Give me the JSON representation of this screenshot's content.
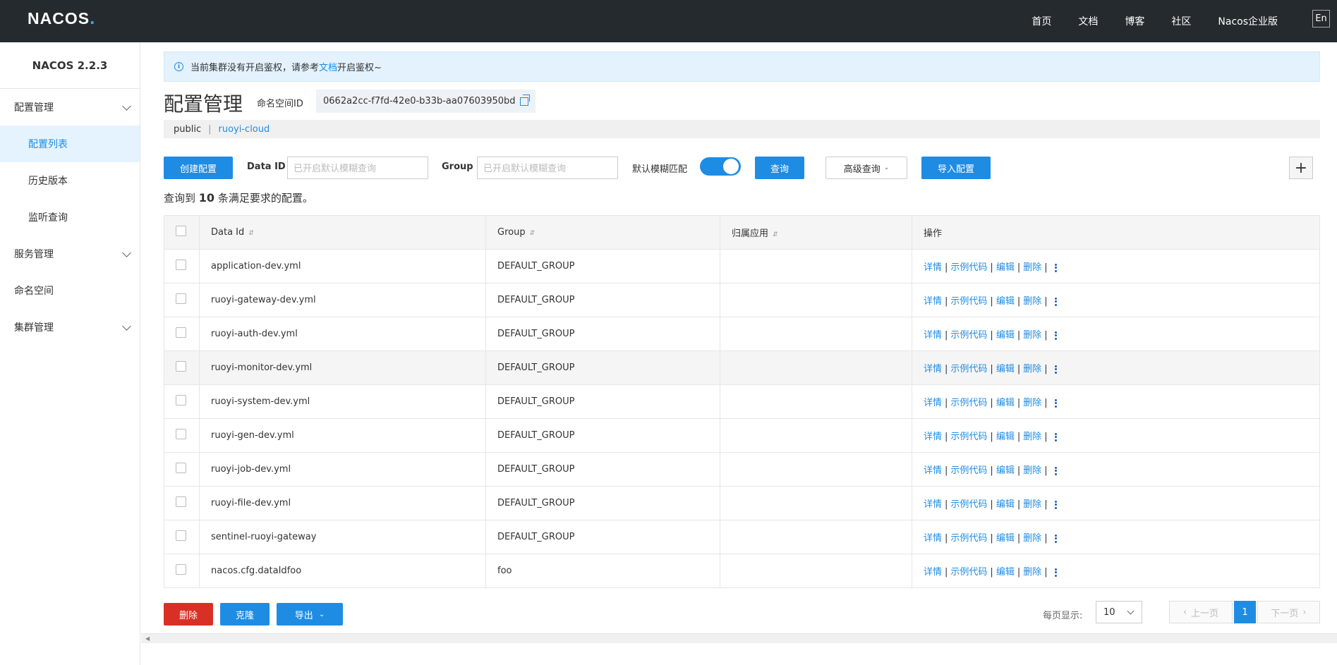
{
  "header": {
    "logo": "NACOS",
    "logo_dot": ".",
    "nav": [
      "首页",
      "文档",
      "博客",
      "社区",
      "Nacos企业版"
    ],
    "lang": "En"
  },
  "sidebar": {
    "version": "NACOS 2.2.3",
    "items": [
      {
        "label": "配置管理",
        "expandable": true
      },
      {
        "label": "配置列表",
        "active": true
      },
      {
        "label": "历史版本"
      },
      {
        "label": "监听查询"
      },
      {
        "label": "服务管理",
        "expandable": true
      },
      {
        "label": "命名空间"
      },
      {
        "label": "集群管理",
        "expandable": true
      }
    ]
  },
  "notice": {
    "text_before": "当前集群没有开启鉴权，请参考",
    "link": "文档",
    "text_after": "开启鉴权~"
  },
  "page": {
    "title": "配置管理",
    "namespace_label": "命名空间ID",
    "namespace_id": "0662a2cc-f7fd-42e0-b33b-aa07603950bd",
    "ns_public": "public",
    "ns_sep": "|",
    "ns_current": "ruoyi-cloud"
  },
  "toolbar": {
    "create": "创建配置",
    "dataid_label": "Data ID",
    "dataid_placeholder": "已开启默认模糊查询",
    "group_label": "Group",
    "group_placeholder": "已开启默认模糊查询",
    "fuzzy_label": "默认模糊匹配",
    "fuzzy_on": true,
    "query": "查询",
    "advanced": "高级查询",
    "import": "导入配置",
    "plus": "+"
  },
  "summary": {
    "prefix": "查询到",
    "count": "10",
    "suffix": "条满足要求的配置。"
  },
  "table": {
    "columns": [
      "Data Id",
      "Group",
      "归属应用",
      "操作"
    ],
    "ops": [
      "详情",
      "示例代码",
      "编辑",
      "删除"
    ],
    "rows": [
      {
        "data_id": "application-dev.yml",
        "group": "DEFAULT_GROUP",
        "app": ""
      },
      {
        "data_id": "ruoyi-gateway-dev.yml",
        "group": "DEFAULT_GROUP",
        "app": ""
      },
      {
        "data_id": "ruoyi-auth-dev.yml",
        "group": "DEFAULT_GROUP",
        "app": ""
      },
      {
        "data_id": "ruoyi-monitor-dev.yml",
        "group": "DEFAULT_GROUP",
        "app": ""
      },
      {
        "data_id": "ruoyi-system-dev.yml",
        "group": "DEFAULT_GROUP",
        "app": ""
      },
      {
        "data_id": "ruoyi-gen-dev.yml",
        "group": "DEFAULT_GROUP",
        "app": ""
      },
      {
        "data_id": "ruoyi-job-dev.yml",
        "group": "DEFAULT_GROUP",
        "app": ""
      },
      {
        "data_id": "ruoyi-file-dev.yml",
        "group": "DEFAULT_GROUP",
        "app": ""
      },
      {
        "data_id": "sentinel-ruoyi-gateway",
        "group": "DEFAULT_GROUP",
        "app": ""
      },
      {
        "data_id": "nacos.cfg.dataIdfoo",
        "group": "foo",
        "app": ""
      }
    ]
  },
  "footer": {
    "delete": "删除",
    "clone": "克隆",
    "export": "导出",
    "page_size_label": "每页显示:",
    "page_size": "10",
    "prev": "上一页",
    "current_page": "1",
    "next": "下一页"
  }
}
